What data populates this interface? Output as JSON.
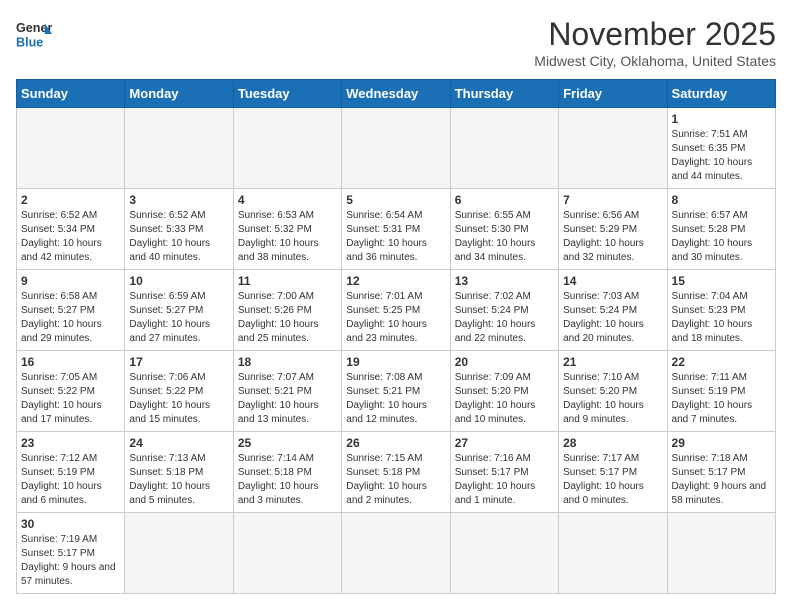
{
  "header": {
    "logo_general": "General",
    "logo_blue": "Blue",
    "title": "November 2025",
    "location": "Midwest City, Oklahoma, United States"
  },
  "days_of_week": [
    "Sunday",
    "Monday",
    "Tuesday",
    "Wednesday",
    "Thursday",
    "Friday",
    "Saturday"
  ],
  "weeks": [
    [
      {
        "day": "",
        "info": ""
      },
      {
        "day": "",
        "info": ""
      },
      {
        "day": "",
        "info": ""
      },
      {
        "day": "",
        "info": ""
      },
      {
        "day": "",
        "info": ""
      },
      {
        "day": "",
        "info": ""
      },
      {
        "day": "1",
        "info": "Sunrise: 7:51 AM\nSunset: 6:35 PM\nDaylight: 10 hours and 44 minutes."
      }
    ],
    [
      {
        "day": "2",
        "info": "Sunrise: 6:52 AM\nSunset: 5:34 PM\nDaylight: 10 hours and 42 minutes."
      },
      {
        "day": "3",
        "info": "Sunrise: 6:52 AM\nSunset: 5:33 PM\nDaylight: 10 hours and 40 minutes."
      },
      {
        "day": "4",
        "info": "Sunrise: 6:53 AM\nSunset: 5:32 PM\nDaylight: 10 hours and 38 minutes."
      },
      {
        "day": "5",
        "info": "Sunrise: 6:54 AM\nSunset: 5:31 PM\nDaylight: 10 hours and 36 minutes."
      },
      {
        "day": "6",
        "info": "Sunrise: 6:55 AM\nSunset: 5:30 PM\nDaylight: 10 hours and 34 minutes."
      },
      {
        "day": "7",
        "info": "Sunrise: 6:56 AM\nSunset: 5:29 PM\nDaylight: 10 hours and 32 minutes."
      },
      {
        "day": "8",
        "info": "Sunrise: 6:57 AM\nSunset: 5:28 PM\nDaylight: 10 hours and 30 minutes."
      }
    ],
    [
      {
        "day": "9",
        "info": "Sunrise: 6:58 AM\nSunset: 5:27 PM\nDaylight: 10 hours and 29 minutes."
      },
      {
        "day": "10",
        "info": "Sunrise: 6:59 AM\nSunset: 5:27 PM\nDaylight: 10 hours and 27 minutes."
      },
      {
        "day": "11",
        "info": "Sunrise: 7:00 AM\nSunset: 5:26 PM\nDaylight: 10 hours and 25 minutes."
      },
      {
        "day": "12",
        "info": "Sunrise: 7:01 AM\nSunset: 5:25 PM\nDaylight: 10 hours and 23 minutes."
      },
      {
        "day": "13",
        "info": "Sunrise: 7:02 AM\nSunset: 5:24 PM\nDaylight: 10 hours and 22 minutes."
      },
      {
        "day": "14",
        "info": "Sunrise: 7:03 AM\nSunset: 5:24 PM\nDaylight: 10 hours and 20 minutes."
      },
      {
        "day": "15",
        "info": "Sunrise: 7:04 AM\nSunset: 5:23 PM\nDaylight: 10 hours and 18 minutes."
      }
    ],
    [
      {
        "day": "16",
        "info": "Sunrise: 7:05 AM\nSunset: 5:22 PM\nDaylight: 10 hours and 17 minutes."
      },
      {
        "day": "17",
        "info": "Sunrise: 7:06 AM\nSunset: 5:22 PM\nDaylight: 10 hours and 15 minutes."
      },
      {
        "day": "18",
        "info": "Sunrise: 7:07 AM\nSunset: 5:21 PM\nDaylight: 10 hours and 13 minutes."
      },
      {
        "day": "19",
        "info": "Sunrise: 7:08 AM\nSunset: 5:21 PM\nDaylight: 10 hours and 12 minutes."
      },
      {
        "day": "20",
        "info": "Sunrise: 7:09 AM\nSunset: 5:20 PM\nDaylight: 10 hours and 10 minutes."
      },
      {
        "day": "21",
        "info": "Sunrise: 7:10 AM\nSunset: 5:20 PM\nDaylight: 10 hours and 9 minutes."
      },
      {
        "day": "22",
        "info": "Sunrise: 7:11 AM\nSunset: 5:19 PM\nDaylight: 10 hours and 7 minutes."
      }
    ],
    [
      {
        "day": "23",
        "info": "Sunrise: 7:12 AM\nSunset: 5:19 PM\nDaylight: 10 hours and 6 minutes."
      },
      {
        "day": "24",
        "info": "Sunrise: 7:13 AM\nSunset: 5:18 PM\nDaylight: 10 hours and 5 minutes."
      },
      {
        "day": "25",
        "info": "Sunrise: 7:14 AM\nSunset: 5:18 PM\nDaylight: 10 hours and 3 minutes."
      },
      {
        "day": "26",
        "info": "Sunrise: 7:15 AM\nSunset: 5:18 PM\nDaylight: 10 hours and 2 minutes."
      },
      {
        "day": "27",
        "info": "Sunrise: 7:16 AM\nSunset: 5:17 PM\nDaylight: 10 hours and 1 minute."
      },
      {
        "day": "28",
        "info": "Sunrise: 7:17 AM\nSunset: 5:17 PM\nDaylight: 10 hours and 0 minutes."
      },
      {
        "day": "29",
        "info": "Sunrise: 7:18 AM\nSunset: 5:17 PM\nDaylight: 9 hours and 58 minutes."
      }
    ],
    [
      {
        "day": "30",
        "info": "Sunrise: 7:19 AM\nSunset: 5:17 PM\nDaylight: 9 hours and 57 minutes."
      },
      {
        "day": "",
        "info": ""
      },
      {
        "day": "",
        "info": ""
      },
      {
        "day": "",
        "info": ""
      },
      {
        "day": "",
        "info": ""
      },
      {
        "day": "",
        "info": ""
      },
      {
        "day": "",
        "info": ""
      }
    ]
  ]
}
